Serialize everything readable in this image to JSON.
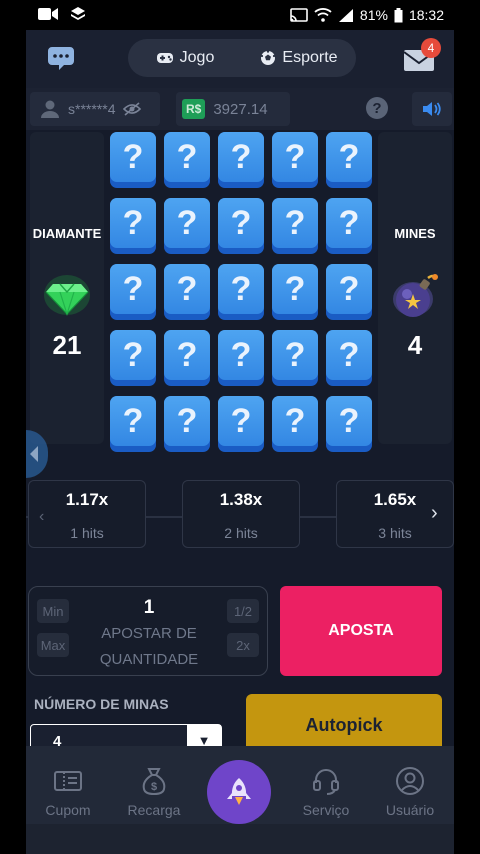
{
  "status_bar": {
    "battery": "81%",
    "time": "18:32"
  },
  "header": {
    "tabs": [
      {
        "label": "Jogo"
      },
      {
        "label": "Esporte"
      }
    ],
    "mail_badge": "4"
  },
  "user": {
    "name": "s******4",
    "currency": "R$",
    "balance": "3927.14"
  },
  "game": {
    "diamonds_label": "DIAMANTE",
    "diamonds_count": "21",
    "mines_label": "MINES",
    "mines_count": "4",
    "tile_symbol": "?",
    "rows": 5,
    "cols": 5
  },
  "multipliers": [
    {
      "value": "1.17x",
      "hits": "1 hits"
    },
    {
      "value": "1.38x",
      "hits": "2 hits"
    },
    {
      "value": "1.65x",
      "hits": "3 hits"
    }
  ],
  "bet": {
    "quantity": "1",
    "label": "APOSTAR DE QUANTIDADE",
    "min": "Min",
    "max": "Max",
    "half": "1/2",
    "double": "2x",
    "button": "APOSTA"
  },
  "mines_select": {
    "label": "NÚMERO DE MINAS",
    "value": "4"
  },
  "autopick": "Autopick",
  "nav": [
    {
      "label": "Cupom",
      "icon": "coupon-icon"
    },
    {
      "label": "Recarga",
      "icon": "moneybag-icon"
    },
    {
      "label": "",
      "icon": "rocket-icon"
    },
    {
      "label": "Serviço",
      "icon": "headset-icon"
    },
    {
      "label": "Usuário",
      "icon": "user-icon"
    }
  ],
  "colors": {
    "bet_button": "#ec2063",
    "autopick": "#c4960f",
    "tile": "#3f96ea",
    "center_nav": "#6f45c9"
  }
}
